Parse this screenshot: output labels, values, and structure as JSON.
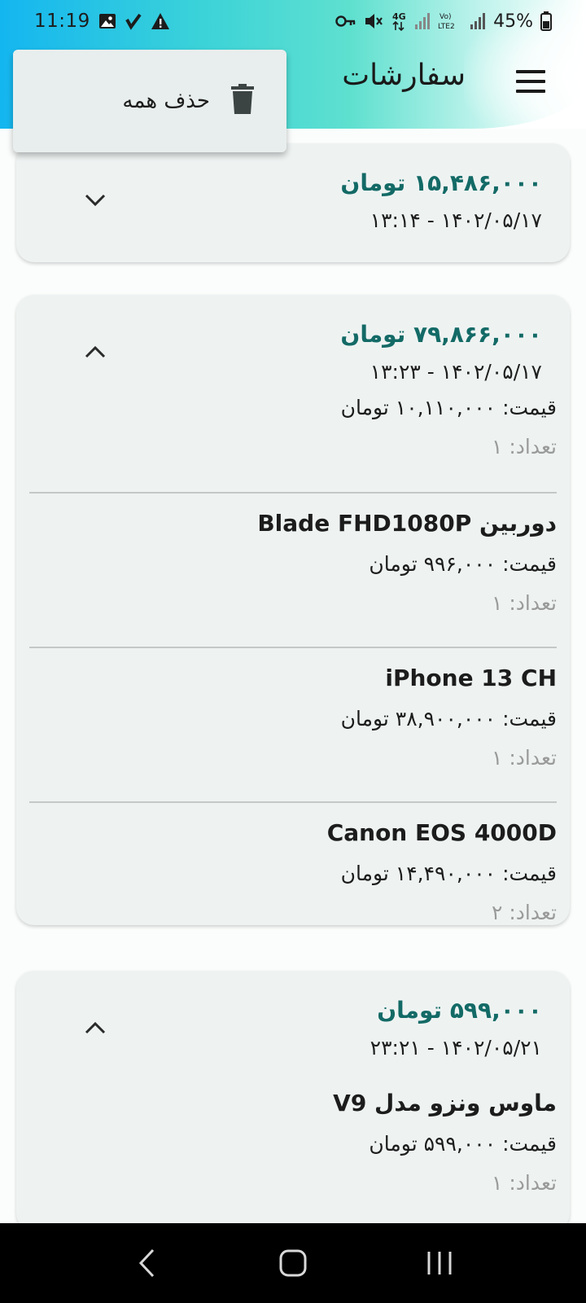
{
  "status_bar": {
    "time": "11:19",
    "battery": "45%",
    "icons": [
      "image-icon",
      "check-icon",
      "warning-icon",
      "key-icon",
      "mute-icon",
      "4g-icon",
      "signal-icon",
      "volte-icon",
      "signal-icon",
      "battery-icon"
    ],
    "lte_label": "Vo) LTE2",
    "net_label": "4G"
  },
  "toolbar": {
    "title": "سفارشات",
    "menu_icon": "hamburger-menu-icon"
  },
  "popup_menu": {
    "items": [
      {
        "label": "حذف همه",
        "icon": "trash-icon"
      }
    ]
  },
  "orders": [
    {
      "total": "۱۵,۴۸۶,۰۰۰ تومان",
      "date": "۱۳:۱۴  -  ۱۴۰۲/۰۵/۱۷",
      "expanded": false,
      "chevron": "chevron-down-icon",
      "items": []
    },
    {
      "total": "۷۹,۸۶۶,۰۰۰ تومان",
      "date": "۱۳:۲۳  -  ۱۴۰۲/۰۵/۱۷",
      "expanded": true,
      "chevron": "chevron-up-icon",
      "items": [
        {
          "name": "",
          "price": "قیمت: ۱۰,۱۱۰,۰۰۰ تومان",
          "qty": "تعداد: ۱"
        },
        {
          "name": "دوربین Blade FHD1080P",
          "price": "قیمت: ۹۹۶,۰۰۰ تومان",
          "qty": "تعداد: ۱"
        },
        {
          "name": "iPhone 13 CH",
          "price": "قیمت: ۳۸,۹۰۰,۰۰۰ تومان",
          "qty": "تعداد: ۱"
        },
        {
          "name": "Canon EOS 4000D",
          "price": "قیمت: ۱۴,۴۹۰,۰۰۰ تومان",
          "qty": "تعداد: ۲"
        }
      ]
    },
    {
      "total": "۵۹۹,۰۰۰ تومان",
      "date": "۲۳:۲۱  -  ۱۴۰۲/۰۵/۲۱",
      "expanded": true,
      "chevron": "chevron-up-icon",
      "items": [
        {
          "name": "ماوس ونزو مدل V9",
          "price": "قیمت: ۵۹۹,۰۰۰ تومان",
          "qty": "تعداد: ۱"
        }
      ]
    }
  ],
  "nav_bar": {
    "buttons": [
      "back-icon",
      "home-icon",
      "recents-icon"
    ]
  },
  "colors": {
    "accent_total": "#136a66",
    "card_bg": "#eef3f2",
    "header_gradient_start": "#14b6f0",
    "header_gradient_mid": "#5fe0cf"
  }
}
